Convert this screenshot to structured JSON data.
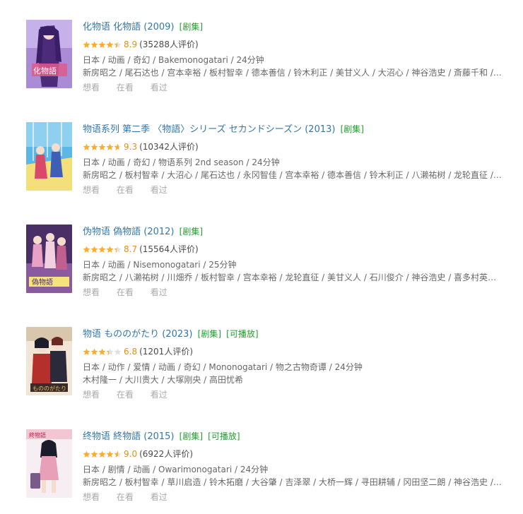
{
  "items": [
    {
      "title": "化物语 化物語 (2009)",
      "tags": [
        "[剧集]"
      ],
      "rating_fraction": 0.89,
      "score": "8.9",
      "votes": "(35288人评价)",
      "meta": "日本 / 动画 / 奇幻 / Bakemonogatari / 24分钟",
      "cast": "新房昭之 / 尾石达也 / 宫本幸裕 / 板村智幸 / 德本善信 / 铃木利正 / 美甘义人 / 大沼心 / 神谷浩史 / 斎藤千和 / 加...",
      "actions": [
        "想看",
        "在看",
        "看过"
      ],
      "poster_colors": [
        "#8d6fc7",
        "#d8a8d8"
      ]
    },
    {
      "title": "物语系列 第二季 〈物語〉シリーズ セカンドシーズン (2013)",
      "tags": [
        "[剧集]"
      ],
      "rating_fraction": 0.93,
      "score": "9.3",
      "votes": "(10342人评价)",
      "meta": "日本 / 动画 / 奇幻 / 物语系列 2nd season / 24分钟",
      "cast": "新房昭之 / 板村智幸 / 大沼心 / 尾石达也 / 永冈智佳 / 宫本幸裕 / 德本善信 / 铃木利正 / 八濑祐树 / 龙轮直征 / 宫...",
      "actions": [
        "想看",
        "在看",
        "看过"
      ],
      "poster_colors": [
        "#4aa8d8",
        "#f0d060"
      ]
    },
    {
      "title": "伪物语 偽物語 (2012)",
      "tags": [
        "[剧集]"
      ],
      "rating_fraction": 0.87,
      "score": "8.7",
      "votes": "(15564人评价)",
      "meta": "日本 / 动画 / Nisemonogatari / 25分钟",
      "cast": "新房昭之 / 八濑祐树 / 川畑乔 / 板村智幸 / 宫本幸裕 / 龙轮直征 / 美甘义人 / 石川俊介 / 神谷浩史 / 喜多村英梨 / ...",
      "actions": [
        "想看",
        "在看",
        "看过"
      ],
      "poster_colors": [
        "#5a3a78",
        "#e3a0c0"
      ]
    },
    {
      "title": "物语 もののがたり (2023)",
      "tags": [
        "[剧集]",
        "[可播放]"
      ],
      "rating_fraction": 0.68,
      "score": "6.8",
      "votes": "(1201人评价)",
      "meta": "日本 / 动作 / 爱情 / 动画 / 奇幻 / Mononogatari / 物之古物奇谭 / 24分钟",
      "cast": "木村隆一 / 大川贵大 / 大塚刚央 / 高田忧希",
      "actions": [
        "想看",
        "在看",
        "看过"
      ],
      "poster_colors": [
        "#b0302a",
        "#2a2a3a"
      ]
    },
    {
      "title": "终物语 終物語 (2015)",
      "tags": [
        "[剧集]",
        "[可播放]"
      ],
      "rating_fraction": 0.9,
      "score": "9.0",
      "votes": "(6922人评价)",
      "meta": "日本 / 剧情 / 动画 / Owarimonogatari / 24分钟",
      "cast": "新房昭之 / 板村智幸 / 草川启造 / 铃木拓磨 / 大谷肇 / 吉泽翠 / 大桥一辉 / 寻田耕辅 / 冈田坚二朗 / 神谷浩史 / 水...",
      "actions": [
        "想看",
        "在看",
        "看过"
      ],
      "poster_colors": [
        "#f2c6d2",
        "#f4eef2"
      ]
    }
  ],
  "colors": {
    "title": "#3377aa",
    "tag": "#1f9e2b",
    "star": "#ffac2d",
    "star_empty": "#e0e0e0",
    "score": "#e09015",
    "muted": "#aaaaaa"
  }
}
